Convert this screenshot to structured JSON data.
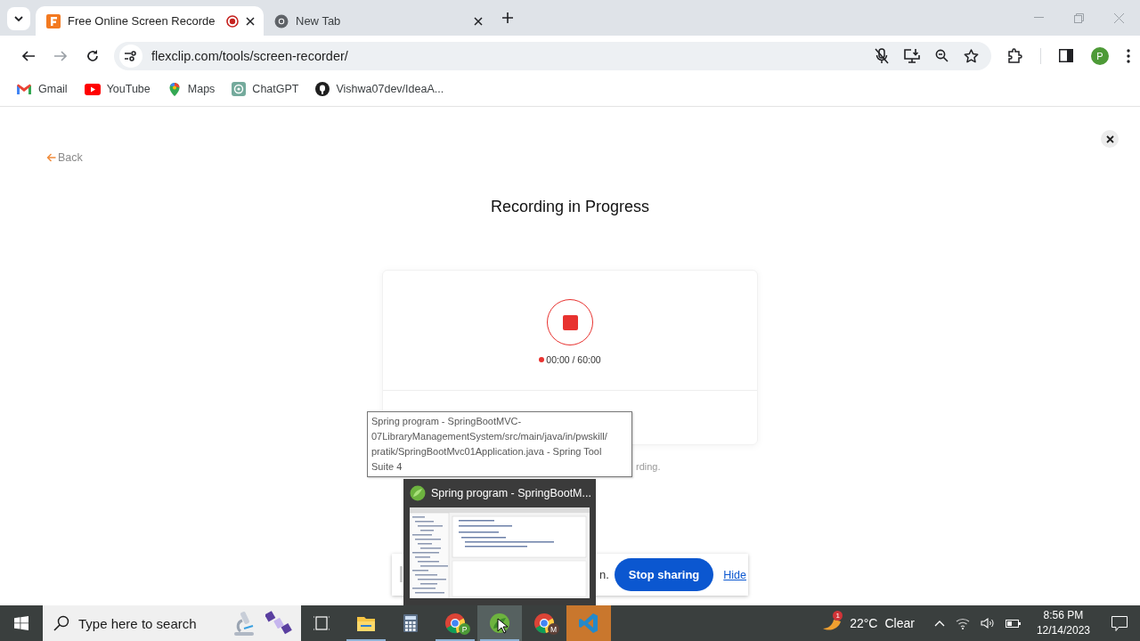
{
  "tabs": [
    {
      "title": "Free Online Screen Recorde",
      "selected": true,
      "recording": true
    },
    {
      "title": "New Tab",
      "selected": false,
      "recording": false
    }
  ],
  "address": "flexclip.com/tools/screen-recorder/",
  "profile_initial": "P",
  "bookmarks": [
    {
      "label": "Gmail",
      "kind": "gmail"
    },
    {
      "label": "YouTube",
      "kind": "youtube"
    },
    {
      "label": "Maps",
      "kind": "maps"
    },
    {
      "label": "ChatGPT",
      "kind": "chatgpt"
    },
    {
      "label": "Vishwa07dev/IdeaA...",
      "kind": "github"
    }
  ],
  "page": {
    "back": "Back",
    "heading": "Recording in Progress",
    "timer": "00:00 / 60:00",
    "note_fragment": "rding."
  },
  "tooltip_lines": [
    "Spring program - SpringBootMVC-",
    "07LibraryManagementSystem/src/main/java/in/pwskill/",
    "pratik/SpringBootMvc01Application.java - Spring Tool",
    "Suite 4"
  ],
  "thumbnail": {
    "title": "Spring program - SpringBootM..."
  },
  "share_bar": {
    "message_fragment": "n.",
    "stop": "Stop sharing",
    "hide": "Hide"
  },
  "taskbar": {
    "search_placeholder": "Type here to search",
    "apps": [
      {
        "kind": "taskview",
        "running": false,
        "highlighted": false
      },
      {
        "kind": "explorer",
        "running": true,
        "highlighted": false
      },
      {
        "kind": "calculator",
        "running": false,
        "highlighted": false
      },
      {
        "kind": "chrome",
        "badge": "P",
        "running": true,
        "highlighted": false
      },
      {
        "kind": "spring",
        "running": true,
        "highlighted": true
      },
      {
        "kind": "chrome",
        "badge": "M",
        "running": false,
        "highlighted": false
      },
      {
        "kind": "vscode",
        "running": false,
        "highlighted": true
      }
    ],
    "weather": {
      "badge": "1",
      "temperature": "22°C",
      "condition": "Clear"
    },
    "time": "8:56 PM",
    "date": "12/14/2023"
  }
}
